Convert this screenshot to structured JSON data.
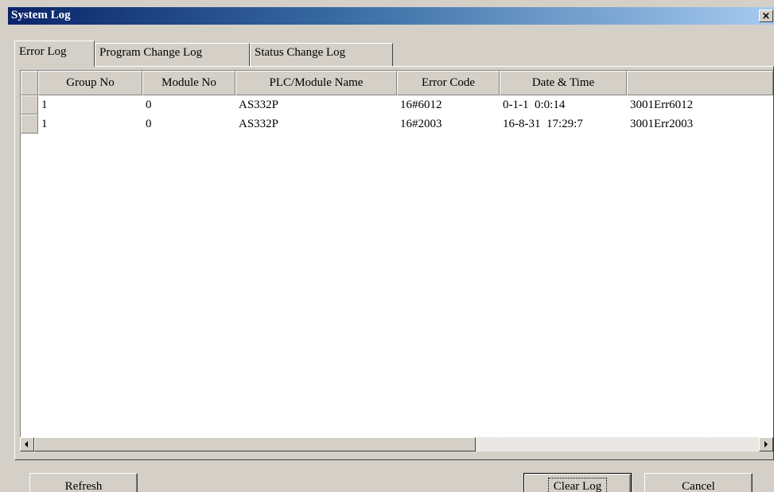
{
  "window": {
    "title": "System Log",
    "close_label": "×"
  },
  "tabs": [
    {
      "label": "Error Log",
      "active": true
    },
    {
      "label": "Program Change Log",
      "active": false
    },
    {
      "label": "Status Change Log",
      "active": false
    }
  ],
  "table": {
    "columns": [
      "Group No",
      "Module No",
      "PLC/Module Name",
      "Error Code",
      "Date & Time",
      ""
    ],
    "rows": [
      [
        "1",
        "0",
        "AS332P",
        "16#6012",
        "0-1-1  0:0:14",
        "3001Err6012"
      ],
      [
        "1",
        "0",
        "AS332P",
        "16#2003",
        "16-8-31  17:29:7",
        "3001Err2003"
      ]
    ]
  },
  "buttons": {
    "refresh": "Refresh",
    "clear_log": "Clear Log",
    "cancel": "Cancel"
  },
  "colors": {
    "title_start": "#0a246a",
    "title_end": "#a6caf0",
    "face": "#d4d0c8"
  }
}
